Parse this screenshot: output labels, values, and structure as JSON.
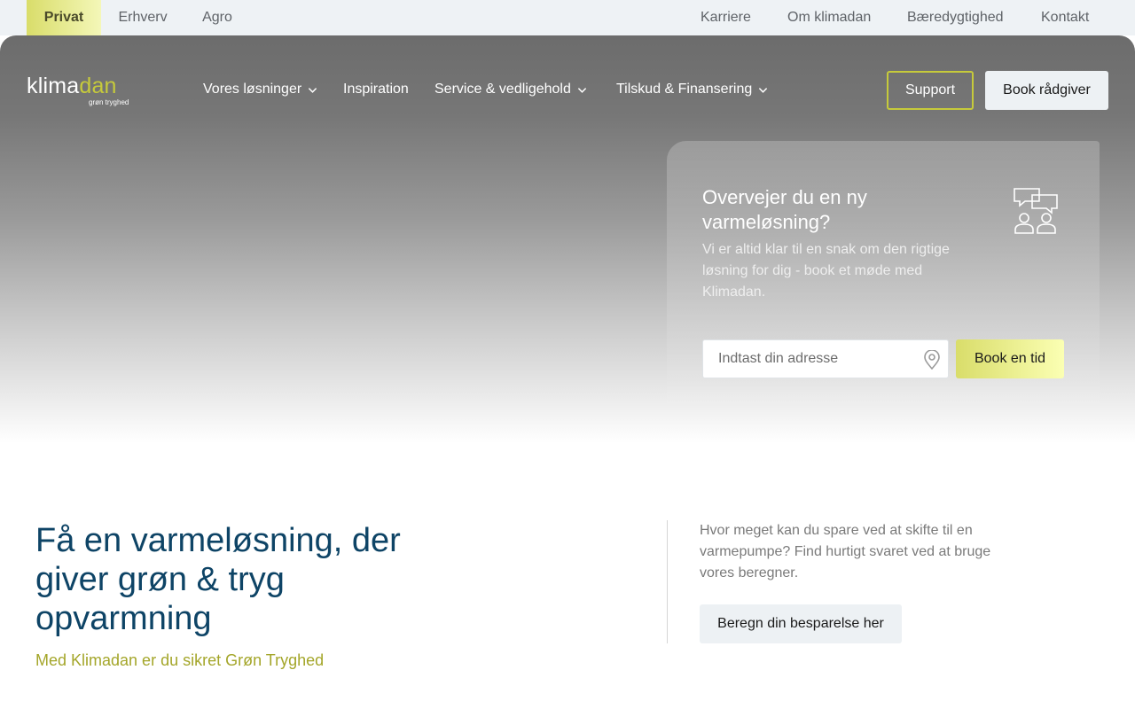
{
  "segments": [
    {
      "label": "Privat",
      "active": true
    },
    {
      "label": "Erhverv",
      "active": false
    },
    {
      "label": "Agro",
      "active": false
    }
  ],
  "utility_links": [
    "Karriere",
    "Om klimadan",
    "Bæredygtighed",
    "Kontakt"
  ],
  "logo": {
    "text_part1": "klima",
    "text_part2": "dan",
    "tagline": "grøn tryghed"
  },
  "nav": [
    {
      "label": "Vores løsninger",
      "has_dropdown": true
    },
    {
      "label": "Inspiration",
      "has_dropdown": false
    },
    {
      "label": "Service & vedligehold",
      "has_dropdown": true
    },
    {
      "label": "Tilskud & Finansering",
      "has_dropdown": true
    }
  ],
  "header_buttons": {
    "support": "Support",
    "book_advisor": "Book rådgiver"
  },
  "booking_card": {
    "title": "Overvejer du en ny varmeløsning?",
    "text": "Vi er altid klar til en snak om den rigtige løsning for dig - book et møde med Klimadan.",
    "address_placeholder": "Indtast din adresse",
    "address_value": "",
    "button": "Book en tid",
    "icon": "chat-people-icon"
  },
  "main": {
    "headline": "Få en varmeløsning, der giver grøn & tryg opvarmning",
    "subline": "Med Klimadan er du sikret Grøn Tryghed",
    "savings_text": "Hvor meget kan du spare ved at skifte til en varmepumpe? Find hurtigt svaret ved at bruge vores beregner.",
    "calc_button": "Beregn din besparelse her"
  },
  "colors": {
    "accent_yellow": "#c6ca3b",
    "headline_blue": "#0e4466",
    "subline_olive": "#a4a62a",
    "topbar_bg": "#eef2f5"
  }
}
